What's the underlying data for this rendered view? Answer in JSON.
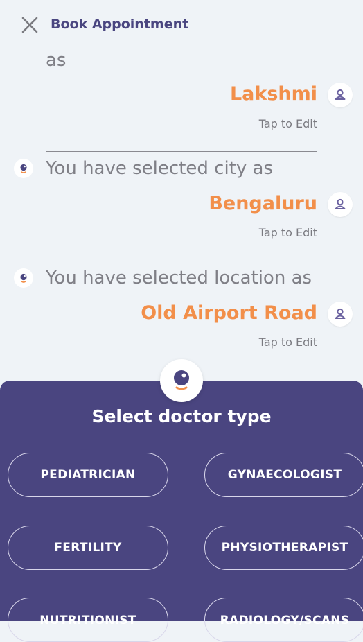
{
  "header": {
    "title": "Book Appointment"
  },
  "conversation": {
    "name_prefix": "as",
    "name_value": "Lakshmi",
    "city_prompt": "You have selected city  as",
    "city_value": "Bengaluru",
    "location_prompt": "You have selected location as",
    "location_value": "Old Airport Road",
    "edit_label": "Tap to Edit"
  },
  "panel": {
    "title": "Select doctor type",
    "options": [
      "PEDIATRICIAN",
      "GYNAECOLOGIST",
      "FERTILITY",
      "PHYSIOTHERAPIST",
      "NUTRITIONIST",
      "RADIOLOGY/SCANS"
    ]
  },
  "colors": {
    "accent_orange": "#f28f4a",
    "panel_purple": "#4a4580",
    "background": "#eff3f7"
  },
  "icons": {
    "close": "close-icon",
    "user": "user-icon",
    "assistant": "bot-icon"
  }
}
